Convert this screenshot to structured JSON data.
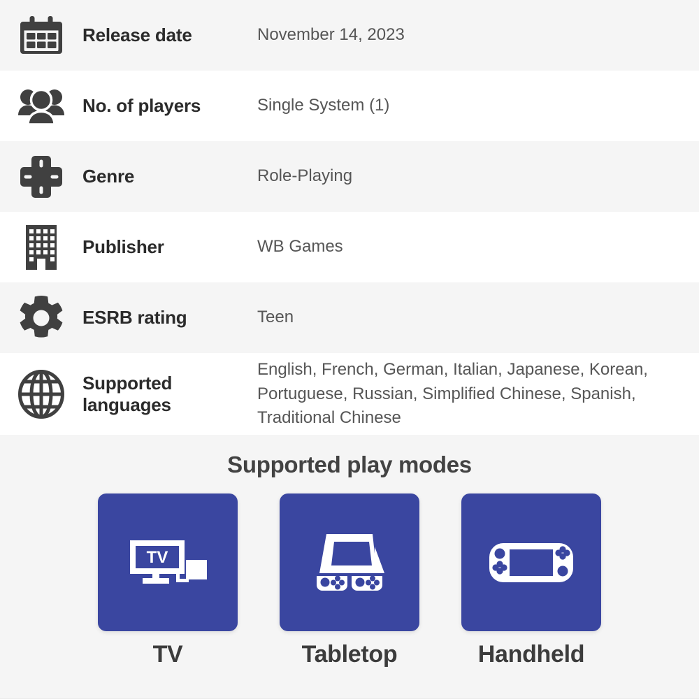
{
  "spec_rows": [
    {
      "icon": "calendar-icon",
      "label": "Release date",
      "value": "November 14, 2023"
    },
    {
      "icon": "players-group-icon",
      "label": "No. of players",
      "value": "Single System (1)"
    },
    {
      "icon": "dpad-icon",
      "label": "Genre",
      "value": "Role-Playing"
    },
    {
      "icon": "building-icon",
      "label": "Publisher",
      "value": "WB Games"
    },
    {
      "icon": "gear-icon",
      "label": "ESRB rating",
      "value": "Teen"
    },
    {
      "icon": "globe-icon",
      "label": "Supported languages",
      "value": "English, French, German, Italian, Japanese, Korean, Portuguese, Russian, Simplified Chinese, Spanish, Traditional Chinese"
    }
  ],
  "play_modes": {
    "title": "Supported play modes",
    "modes": [
      {
        "icon": "tv-dock-icon",
        "label": "TV",
        "screen_text": "TV"
      },
      {
        "icon": "tabletop-console-icon",
        "label": "Tabletop"
      },
      {
        "icon": "handheld-console-icon",
        "label": "Handheld"
      }
    ]
  },
  "colors": {
    "tile_blue": "#3a46a0",
    "row_alt_background": "#f5f5f5",
    "row_background": "#ffffff",
    "label_text": "#2b2b2b",
    "value_text": "#565656",
    "icon_gray": "#404040"
  }
}
